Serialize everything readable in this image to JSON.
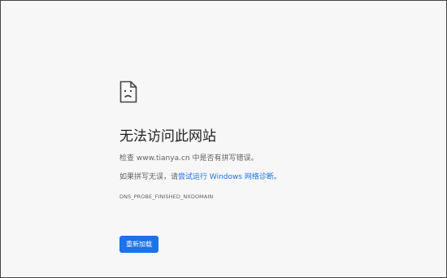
{
  "error": {
    "icon": "sad-page-icon",
    "title": "无法访问此网站",
    "check_prefix": "检查 ",
    "domain": "www.tianya.cn",
    "check_suffix": " 中是否有拼写错误。",
    "suggest_prefix": "如果拼写无误，请",
    "suggest_link": "尝试运行 Windows 网络诊断",
    "suggest_suffix": "。",
    "code": "DNS_PROBE_FINISHED_NXDOMAIN",
    "reload_label": "重新加载"
  },
  "colors": {
    "background": "#f7f7f7",
    "link": "#1a73e8",
    "button": "#1a73e8",
    "text": "#202124",
    "secondary_text": "#5f6368"
  }
}
